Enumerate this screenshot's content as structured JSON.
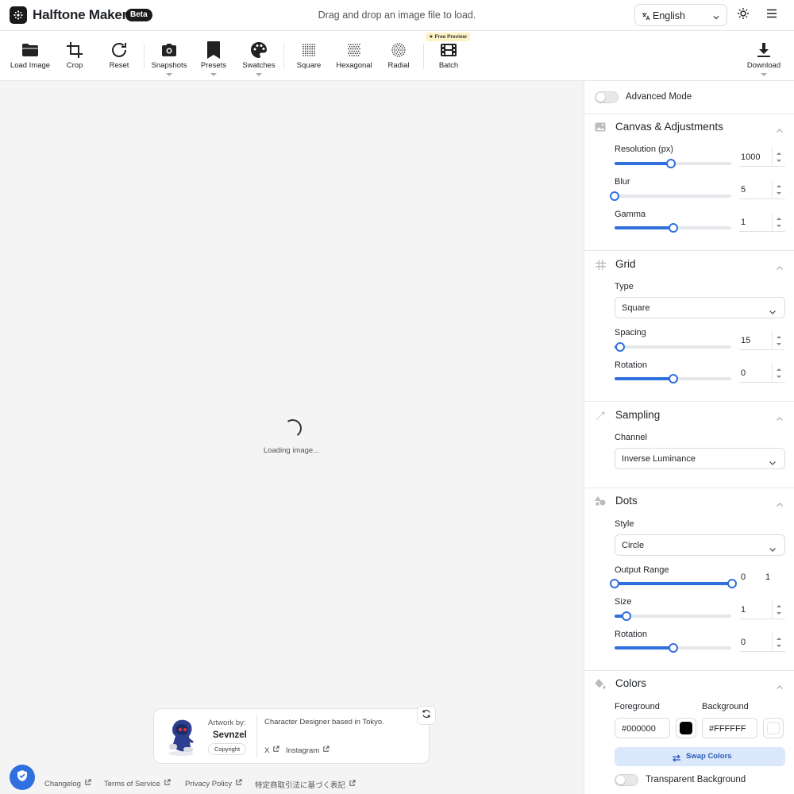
{
  "header": {
    "app_title": "Halftone Maker",
    "beta_badge": "Beta",
    "drop_hint": "Drag and drop an image file to load.",
    "language": "English"
  },
  "toolbar": {
    "load_image": "Load Image",
    "crop": "Crop",
    "reset": "Reset",
    "snapshots": "Snapshots",
    "presets": "Presets",
    "swatches": "Swatches",
    "square": "Square",
    "hexagonal": "Hexagonal",
    "radial": "Radial",
    "batch_badge": "Free Preview",
    "batch": "Batch",
    "download": "Download"
  },
  "canvas": {
    "loading_text": "Loading image..."
  },
  "artwork": {
    "by_label": "Artwork by:",
    "artist": "Sevnzel",
    "copyright": "Copyright",
    "description": "Character Designer based in Tokyo.",
    "link_x": "X",
    "link_instagram": "Instagram"
  },
  "footer": {
    "changelog": "Changelog",
    "terms": "Terms of Service",
    "privacy": "Privacy Policy",
    "legal_notice": "特定商取引法に基づく表記"
  },
  "panel": {
    "advanced_mode": "Advanced Mode",
    "canvas_section": {
      "title": "Canvas & Adjustments",
      "resolution_label": "Resolution (px)",
      "resolution_value": "1000",
      "resolution_fraction": 0.48,
      "blur_label": "Blur",
      "blur_value": "5",
      "blur_fraction": 0.0,
      "gamma_label": "Gamma",
      "gamma_value": "1",
      "gamma_fraction": 0.5
    },
    "grid_section": {
      "title": "Grid",
      "type_label": "Type",
      "type_value": "Square",
      "spacing_label": "Spacing",
      "spacing_value": "15",
      "spacing_fraction": 0.05,
      "rotation_label": "Rotation",
      "rotation_value": "0",
      "rotation_fraction": 0.5
    },
    "sampling_section": {
      "title": "Sampling",
      "channel_label": "Channel",
      "channel_value": "Inverse Luminance"
    },
    "dots_section": {
      "title": "Dots",
      "style_label": "Style",
      "style_value": "Circle",
      "output_range_label": "Output Range",
      "output_range_min": "0",
      "output_range_max": "1",
      "size_label": "Size",
      "size_value": "1",
      "size_fraction": 0.1,
      "rotation_label": "Rotation",
      "rotation_value": "0",
      "rotation_fraction": 0.5
    },
    "colors_section": {
      "title": "Colors",
      "foreground_label": "Foreground",
      "foreground_value": "#000000",
      "background_label": "Background",
      "background_value": "#FFFFFF",
      "swap_label": "Swap Colors",
      "transparent_label": "Transparent Background"
    }
  },
  "colors": {
    "accent": "#2f6fde",
    "foreground_swatch": "#000000",
    "background_swatch": "#ffffff"
  }
}
